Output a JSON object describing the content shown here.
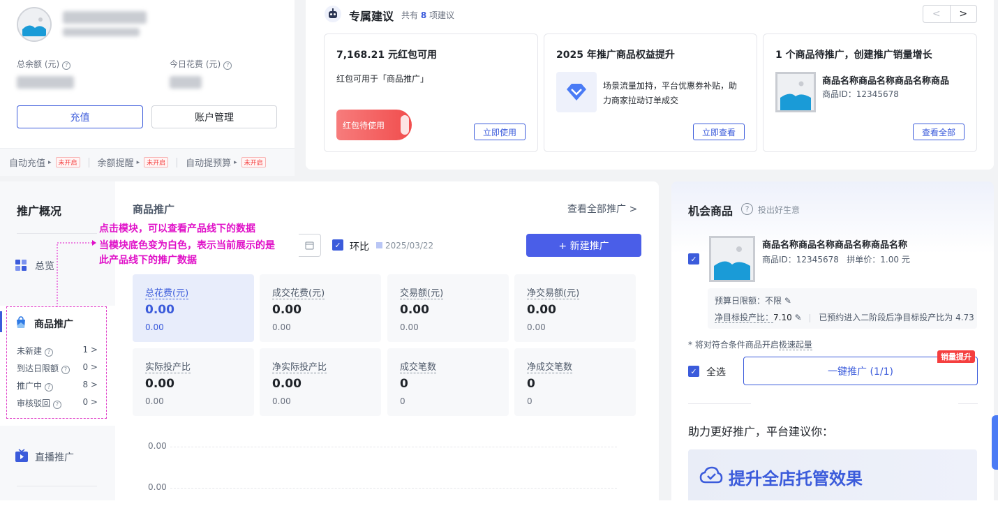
{
  "account": {
    "total_balance_label": "总余额 (元)",
    "today_spend_label": "今日花费 (元)",
    "recharge_button": "充值",
    "manage_button": "账户管理",
    "auto_items": [
      {
        "label": "自动充值",
        "status": "未开启"
      },
      {
        "label": "余额提醒",
        "status": "未开启"
      },
      {
        "label": "自动提预算",
        "status": "未开启"
      }
    ]
  },
  "suggestions": {
    "title": "专属建议",
    "count_prefix": "共有",
    "count": "8",
    "count_suffix": "项建议",
    "prev": "<",
    "next": ">",
    "items": [
      {
        "title": "7,168.21 元红包可用",
        "desc": "红包可用于「商品推广」",
        "pill": "红包待使用",
        "button": "立即使用"
      },
      {
        "title": "2025 年推广商品权益提升",
        "desc_line1": "场景流量加持，平台优惠券补贴，助",
        "desc_line2": "力商家拉动订单成交",
        "button": "立即查看"
      },
      {
        "title": "1 个商品待推广，创建推广销量增长",
        "product_name": "商品名称商品名称商品名称商品",
        "product_id": "商品ID：12345678",
        "button": "查看全部"
      }
    ]
  },
  "overview": {
    "title": "推广概况",
    "nav": {
      "overview": "总览",
      "goods": "商品推广",
      "live": "直播推广",
      "sub_items": [
        {
          "label": "未新建",
          "count": "1 >"
        },
        {
          "label": "到达日限额",
          "count": "0 >"
        },
        {
          "label": "推广中",
          "count": "8 >"
        },
        {
          "label": "审核驳回",
          "count": "0 >"
        }
      ]
    },
    "main_title": "商品推广",
    "view_all": "查看全部推广 >",
    "annotation": [
      "点击模块，可以查看产品线下的数据",
      "当模块底色变为白色，表示当前展示的是",
      "此产品线下的推广数据"
    ],
    "compare_label": "环比",
    "compare_date": "2025/03/22",
    "new_button": "+ 新建推广",
    "metrics": [
      {
        "label": "总花费(元)",
        "value": "0.00",
        "sub": "0.00"
      },
      {
        "label": "成交花费(元)",
        "value": "0.00",
        "sub": "0.00"
      },
      {
        "label": "交易额(元)",
        "value": "0.00",
        "sub": "0.00"
      },
      {
        "label": "净交易额(元)",
        "value": "0.00",
        "sub": "0.00"
      },
      {
        "label": "实际投产比",
        "value": "0.00",
        "sub": "0.00"
      },
      {
        "label": "净实际投产比",
        "value": "0.00",
        "sub": "0.00"
      },
      {
        "label": "成交笔数",
        "value": "0",
        "sub": "0"
      },
      {
        "label": "净成交笔数",
        "value": "0",
        "sub": "0"
      }
    ],
    "chart_ticks": [
      "0.00",
      "0.00"
    ]
  },
  "opportunity": {
    "title": "机会商品",
    "subtitle": "投出好生意",
    "product_name": "商品名称商品名称商品名称商品名称",
    "product_meta": "商品ID：12345678   拼单价：1.00 元",
    "budget_line": "预算日限额：不限",
    "roi_prefix": "净目标投产比：",
    "roi_value": "7.10",
    "roi_note": "已预约进入二阶段后净目标投产比为 4.73",
    "notice_prefix": "* 将对符合条件商品开启",
    "notice_link": "极速起量",
    "select_all": "全选",
    "one_click_button": "一键推广 (1/1)",
    "hot_badge": "销量提升",
    "help_title": "助力更好推广，平台建议你：",
    "help_banner": "提升全店托管效果"
  },
  "colors": {
    "accent": "#3b5bdb",
    "annotation": "#e010c8",
    "danger": "#f53f3f"
  }
}
